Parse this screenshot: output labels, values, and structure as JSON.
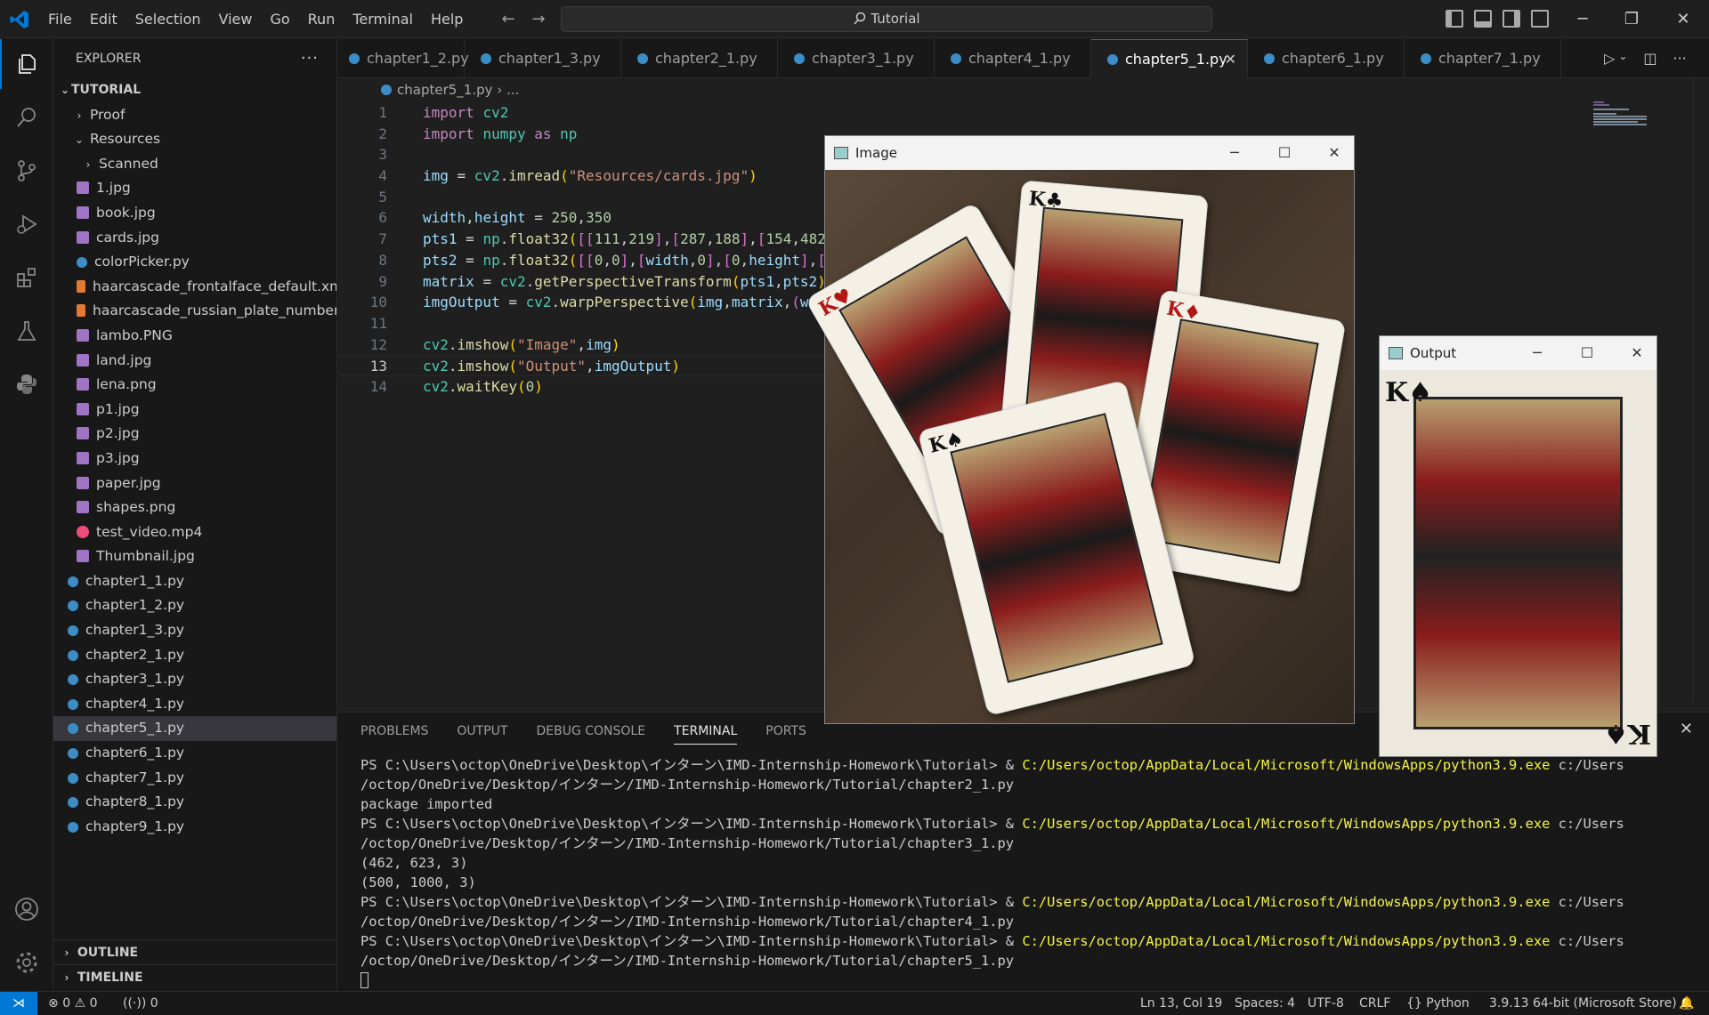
{
  "menu": [
    "File",
    "Edit",
    "Selection",
    "View",
    "Go",
    "Run",
    "Terminal",
    "Help"
  ],
  "command_center": "Tutorial",
  "sidebar": {
    "title": "EXPLORER",
    "root": "TUTORIAL",
    "items": [
      {
        "label": "Proof",
        "type": "folder",
        "depth": 1,
        "open": false
      },
      {
        "label": "Resources",
        "type": "folder",
        "depth": 1,
        "open": true
      },
      {
        "label": "Scanned",
        "type": "folder",
        "depth": 2,
        "open": false
      },
      {
        "label": "1.jpg",
        "type": "img",
        "depth": 2
      },
      {
        "label": "book.jpg",
        "type": "img",
        "depth": 2
      },
      {
        "label": "cards.jpg",
        "type": "img",
        "depth": 2
      },
      {
        "label": "colorPicker.py",
        "type": "py",
        "depth": 2
      },
      {
        "label": "haarcascade_frontalface_default.xml",
        "type": "xml",
        "depth": 2
      },
      {
        "label": "haarcascade_russian_plate_number....",
        "type": "xml",
        "depth": 2
      },
      {
        "label": "lambo.PNG",
        "type": "img",
        "depth": 2
      },
      {
        "label": "land.jpg",
        "type": "img",
        "depth": 2
      },
      {
        "label": "lena.png",
        "type": "img",
        "depth": 2
      },
      {
        "label": "p1.jpg",
        "type": "img",
        "depth": 2
      },
      {
        "label": "p2.jpg",
        "type": "img",
        "depth": 2
      },
      {
        "label": "p3.jpg",
        "type": "img",
        "depth": 2
      },
      {
        "label": "paper.jpg",
        "type": "img",
        "depth": 2
      },
      {
        "label": "shapes.png",
        "type": "img",
        "depth": 2
      },
      {
        "label": "test_video.mp4",
        "type": "mp4",
        "depth": 2
      },
      {
        "label": "Thumbnail.jpg",
        "type": "img",
        "depth": 2
      },
      {
        "label": "chapter1_1.py",
        "type": "py",
        "depth": 1
      },
      {
        "label": "chapter1_2.py",
        "type": "py",
        "depth": 1
      },
      {
        "label": "chapter1_3.py",
        "type": "py",
        "depth": 1
      },
      {
        "label": "chapter2_1.py",
        "type": "py",
        "depth": 1
      },
      {
        "label": "chapter3_1.py",
        "type": "py",
        "depth": 1
      },
      {
        "label": "chapter4_1.py",
        "type": "py",
        "depth": 1
      },
      {
        "label": "chapter5_1.py",
        "type": "py",
        "depth": 1,
        "selected": true
      },
      {
        "label": "chapter6_1.py",
        "type": "py",
        "depth": 1
      },
      {
        "label": "chapter7_1.py",
        "type": "py",
        "depth": 1
      },
      {
        "label": "chapter8_1.py",
        "type": "py",
        "depth": 1
      },
      {
        "label": "chapter9_1.py",
        "type": "py",
        "depth": 1
      }
    ],
    "outline": "OUTLINE",
    "timeline": "TIMELINE"
  },
  "tabs": [
    {
      "label": "chapter1_2.py"
    },
    {
      "label": "chapter1_3.py"
    },
    {
      "label": "chapter2_1.py"
    },
    {
      "label": "chapter3_1.py"
    },
    {
      "label": "chapter4_1.py"
    },
    {
      "label": "chapter5_1.py",
      "active": true
    },
    {
      "label": "chapter6_1.py"
    },
    {
      "label": "chapter7_1.py"
    }
  ],
  "breadcrumb": {
    "file": "chapter5_1.py",
    "rest": "..."
  },
  "code": [
    [
      [
        "k",
        "import "
      ],
      [
        "m",
        "cv2"
      ]
    ],
    [
      [
        "k",
        "import "
      ],
      [
        "m",
        "numpy "
      ],
      [
        "k",
        "as "
      ],
      [
        "m",
        "np"
      ]
    ],
    [],
    [
      [
        "v",
        "img "
      ],
      [
        "p",
        "= "
      ],
      [
        "m",
        "cv2"
      ],
      [
        "p",
        "."
      ],
      [
        "f",
        "imread"
      ],
      [
        "b",
        "("
      ],
      [
        "s",
        "\"Resources/cards.jpg\""
      ],
      [
        "b",
        ")"
      ]
    ],
    [],
    [
      [
        "v",
        "width"
      ],
      [
        "p",
        ","
      ],
      [
        "v",
        "height "
      ],
      [
        "p",
        "= "
      ],
      [
        "n",
        "250"
      ],
      [
        "p",
        ","
      ],
      [
        "n",
        "350"
      ]
    ],
    [
      [
        "v",
        "pts1 "
      ],
      [
        "p",
        "= "
      ],
      [
        "m",
        "np"
      ],
      [
        "p",
        "."
      ],
      [
        "f",
        "float32"
      ],
      [
        "b",
        "("
      ],
      [
        "b2",
        "[["
      ],
      [
        "n",
        "111"
      ],
      [
        "p",
        ","
      ],
      [
        "n",
        "219"
      ],
      [
        "b2",
        "]"
      ],
      [
        "p",
        ","
      ],
      [
        "b2",
        "["
      ],
      [
        "n",
        "287"
      ],
      [
        "p",
        ","
      ],
      [
        "n",
        "188"
      ],
      [
        "b2",
        "]"
      ],
      [
        "p",
        ","
      ],
      [
        "b2",
        "["
      ],
      [
        "n",
        "154"
      ],
      [
        "p",
        ","
      ],
      [
        "n",
        "482"
      ],
      [
        "b2",
        "]"
      ]
    ],
    [
      [
        "v",
        "pts2 "
      ],
      [
        "p",
        "= "
      ],
      [
        "m",
        "np"
      ],
      [
        "p",
        "."
      ],
      [
        "f",
        "float32"
      ],
      [
        "b",
        "("
      ],
      [
        "b2",
        "[["
      ],
      [
        "n",
        "0"
      ],
      [
        "p",
        ","
      ],
      [
        "n",
        "0"
      ],
      [
        "b2",
        "]"
      ],
      [
        "p",
        ","
      ],
      [
        "b2",
        "["
      ],
      [
        "v",
        "width"
      ],
      [
        "p",
        ","
      ],
      [
        "n",
        "0"
      ],
      [
        "b2",
        "]"
      ],
      [
        "p",
        ","
      ],
      [
        "b2",
        "["
      ],
      [
        "n",
        "0"
      ],
      [
        "p",
        ","
      ],
      [
        "v",
        "height"
      ],
      [
        "b2",
        "]"
      ],
      [
        "p",
        ","
      ],
      [
        "b2",
        "["
      ],
      [
        "v",
        "w"
      ]
    ],
    [
      [
        "v",
        "matrix "
      ],
      [
        "p",
        "= "
      ],
      [
        "m",
        "cv2"
      ],
      [
        "p",
        "."
      ],
      [
        "f",
        "getPerspectiveTransform"
      ],
      [
        "b",
        "("
      ],
      [
        "v",
        "pts1"
      ],
      [
        "p",
        ","
      ],
      [
        "v",
        "pts2"
      ],
      [
        "b",
        ")"
      ]
    ],
    [
      [
        "v",
        "imgOutput "
      ],
      [
        "p",
        "= "
      ],
      [
        "m",
        "cv2"
      ],
      [
        "p",
        "."
      ],
      [
        "f",
        "warpPerspective"
      ],
      [
        "b",
        "("
      ],
      [
        "v",
        "img"
      ],
      [
        "p",
        ","
      ],
      [
        "v",
        "matrix"
      ],
      [
        "p",
        ","
      ],
      [
        "b2",
        "("
      ],
      [
        "v",
        "widt"
      ]
    ],
    [],
    [
      [
        "m",
        "cv2"
      ],
      [
        "p",
        "."
      ],
      [
        "f",
        "imshow"
      ],
      [
        "b",
        "("
      ],
      [
        "s",
        "\"Image\""
      ],
      [
        "p",
        ","
      ],
      [
        "v",
        "img"
      ],
      [
        "b",
        ")"
      ]
    ],
    [
      [
        "m",
        "cv2"
      ],
      [
        "p",
        "."
      ],
      [
        "f",
        "imshow"
      ],
      [
        "b",
        "("
      ],
      [
        "s",
        "\"Output\""
      ],
      [
        "p",
        ","
      ],
      [
        "v",
        "imgOutput"
      ],
      [
        "b",
        ")"
      ]
    ],
    [
      [
        "m",
        "cv2"
      ],
      [
        "p",
        "."
      ],
      [
        "f",
        "waitKey"
      ],
      [
        "b",
        "("
      ],
      [
        "n",
        "0"
      ],
      [
        "b",
        ")"
      ]
    ]
  ],
  "current_line": 13,
  "panel": {
    "tabs": [
      "PROBLEMS",
      "OUTPUT",
      "DEBUG CONSOLE",
      "TERMINAL",
      "PORTS"
    ],
    "active_tab": "TERMINAL",
    "lines": [
      [
        [
          "",
          "PS C:\\Users\\octop\\OneDrive\\Desktop\\インターン\\IMD-Internship-Homework\\Tutorial> & "
        ],
        [
          "y",
          "C:/Users/octop/AppData/Local/Microsoft/WindowsApps/python3.9.exe"
        ],
        [
          "",
          " c:/Users"
        ]
      ],
      [
        [
          "",
          "/octop/OneDrive/Desktop/インターン/IMD-Internship-Homework/Tutorial/chapter2_1.py"
        ]
      ],
      [
        [
          "",
          "package imported"
        ]
      ],
      [
        [
          "",
          "PS C:\\Users\\octop\\OneDrive\\Desktop\\インターン\\IMD-Internship-Homework\\Tutorial> & "
        ],
        [
          "y",
          "C:/Users/octop/AppData/Local/Microsoft/WindowsApps/python3.9.exe"
        ],
        [
          "",
          " c:/Users"
        ]
      ],
      [
        [
          "",
          "/octop/OneDrive/Desktop/インターン/IMD-Internship-Homework/Tutorial/chapter3_1.py"
        ]
      ],
      [
        [
          "",
          "(462, 623, 3)"
        ]
      ],
      [
        [
          "",
          "(500, 1000, 3)"
        ]
      ],
      [
        [
          "",
          "PS C:\\Users\\octop\\OneDrive\\Desktop\\インターン\\IMD-Internship-Homework\\Tutorial> & "
        ],
        [
          "y",
          "C:/Users/octop/AppData/Local/Microsoft/WindowsApps/python3.9.exe"
        ],
        [
          "",
          " c:/Users"
        ]
      ],
      [
        [
          "",
          "/octop/OneDrive/Desktop/インターン/IMD-Internship-Homework/Tutorial/chapter4_1.py"
        ]
      ],
      [
        [
          "",
          "PS C:\\Users\\octop\\OneDrive\\Desktop\\インターン\\IMD-Internship-Homework\\Tutorial> & "
        ],
        [
          "y",
          "C:/Users/octop/AppData/Local/Microsoft/WindowsApps/python3.9.exe"
        ],
        [
          "",
          " c:/Users"
        ]
      ],
      [
        [
          "",
          "/octop/OneDrive/Desktop/インターン/IMD-Internship-Homework/Tutorial/chapter5_1.py"
        ]
      ]
    ]
  },
  "windows": {
    "image": {
      "title": "Image"
    },
    "output": {
      "title": "Output"
    }
  },
  "status": {
    "errors": "0",
    "warnings": "0",
    "ports": "0",
    "position": "Ln 13, Col 19",
    "spaces": "Spaces: 4",
    "encoding": "UTF-8",
    "eol": "CRLF",
    "language": "Python",
    "interpreter": "3.9.13 64-bit (Microsoft Store)"
  },
  "colors": {
    "accent": "#0078d4",
    "terminal_path": "#f5f543"
  }
}
